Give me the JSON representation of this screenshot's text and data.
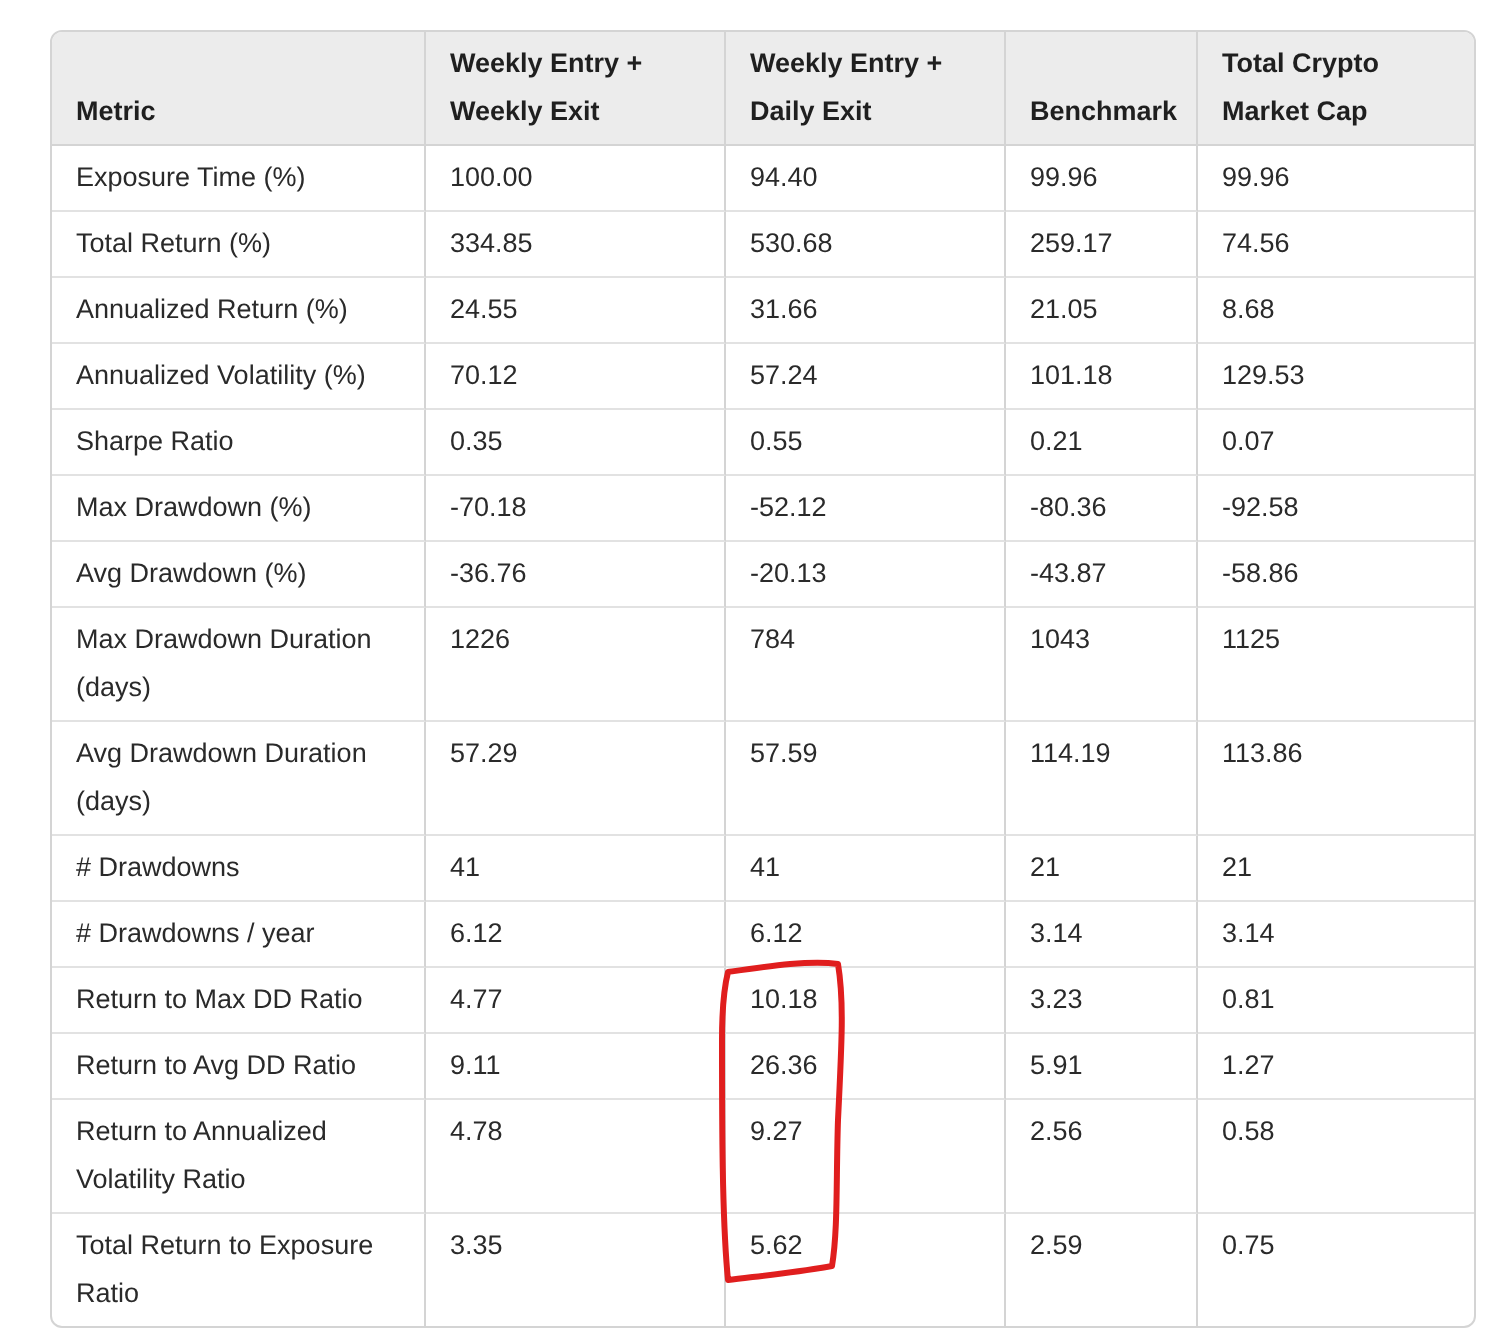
{
  "table": {
    "columns": [
      "Metric",
      "Weekly Entry + Weekly Exit",
      "Weekly Entry + Daily Exit",
      "Benchmark",
      "Total Crypto Market Cap"
    ],
    "rows": [
      [
        "Exposure Time (%)",
        "100.00",
        "94.40",
        "99.96",
        "99.96"
      ],
      [
        "Total Return (%)",
        "334.85",
        "530.68",
        "259.17",
        "74.56"
      ],
      [
        "Annualized Return (%)",
        "24.55",
        "31.66",
        "21.05",
        "8.68"
      ],
      [
        "Annualized Volatility (%)",
        "70.12",
        "57.24",
        "101.18",
        "129.53"
      ],
      [
        "Sharpe Ratio",
        "0.35",
        "0.55",
        "0.21",
        "0.07"
      ],
      [
        "Max Drawdown (%)",
        "-70.18",
        "-52.12",
        "-80.36",
        "-92.58"
      ],
      [
        "Avg Drawdown (%)",
        "-36.76",
        "-20.13",
        "-43.87",
        "-58.86"
      ],
      [
        "Max Drawdown Duration (days)",
        "1226",
        "784",
        "1043",
        "1125"
      ],
      [
        "Avg Drawdown Duration (days)",
        "57.29",
        "57.59",
        "114.19",
        "113.86"
      ],
      [
        "# Drawdowns",
        "41",
        "41",
        "21",
        "21"
      ],
      [
        "# Drawdowns / year",
        "6.12",
        "6.12",
        "3.14",
        "3.14"
      ],
      [
        "Return to Max DD Ratio",
        "4.77",
        "10.18",
        "3.23",
        "0.81"
      ],
      [
        "Return to Avg DD Ratio",
        "9.11",
        "26.36",
        "5.91",
        "1.27"
      ],
      [
        "Return to Annualized Volatility Ratio",
        "4.78",
        "9.27",
        "2.56",
        "0.58"
      ],
      [
        "Total Return to Exposure Ratio",
        "3.35",
        "5.62",
        "2.59",
        "0.75"
      ]
    ]
  }
}
